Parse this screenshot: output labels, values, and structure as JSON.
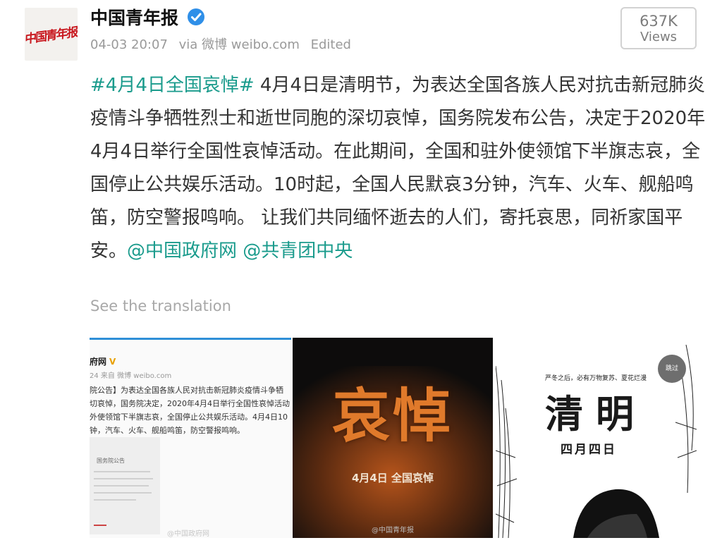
{
  "header": {
    "avatar_text": "中国青年报",
    "user_name": "中国青年报",
    "timestamp": "04-03 20:07",
    "via": "via 微博 weibo.com",
    "edited": "Edited"
  },
  "views": {
    "count": "637K",
    "label": "Views"
  },
  "post": {
    "hashtag": "#4月4日全国哀悼#",
    "body": " 4月4日是清明节，为表达全国各族人民对抗击新冠肺炎疫情斗争牺牲烈士和逝世同胞的深切哀悼，国务院发布公告，决定于2020年4月4日举行全国性哀悼活动。在此期间，全国和驻外使领馆下半旗志哀，全国停止公共娱乐活动。10时起，全国人民默哀3分钟，汽车、火车、舰船鸣笛，防空警报鸣响。 让我们共同缅怀逝去的人们，寄托哀思，同祈家国平安。",
    "mention1": "@中国政府网",
    "mention2": "@共青团中央"
  },
  "translation_link": "See the translation",
  "images": {
    "img1": {
      "name": "府网",
      "meta": "24 来自 微博 weibo.com",
      "body": "院公告】为表达全国各族人民对抗击新冠肺炎疫情斗争牺\n切哀悼，国务院决定，2020年4月4日举行全国性哀悼活动\n外使领馆下半旗志哀，全国停止公共娱乐活动。4月4日10\n钟，汽车、火车、舰船鸣笛，防空警报鸣响。",
      "doc_title": "国务院公告",
      "watermark": "@中国政府网"
    },
    "img2": {
      "title": "哀悼",
      "subtitle": "4月4日  全国哀悼",
      "watermark": "@中国青年报"
    },
    "img3": {
      "skip": "跳过",
      "poem": "严冬之后，必有万物复苏、夏花烂漫",
      "title": "清明",
      "date": "四月四日"
    }
  }
}
